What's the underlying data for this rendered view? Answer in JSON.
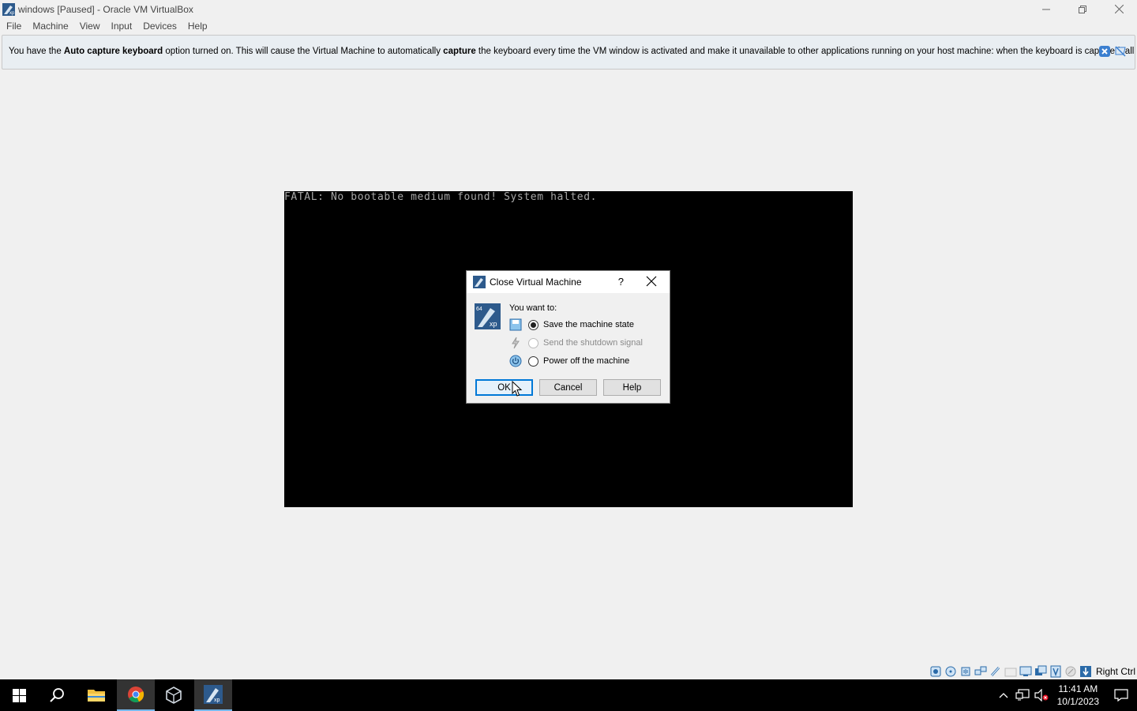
{
  "window": {
    "title": "windows [Paused] - Oracle VM VirtualBox",
    "menu": [
      "File",
      "Machine",
      "View",
      "Input",
      "Devices",
      "Help"
    ]
  },
  "notice": {
    "part1": "You have the ",
    "bold1": "Auto capture keyboard",
    "part2": " option turned on. This will cause the Virtual Machine to automatically ",
    "bold2": "capture",
    "part3": " the keyboard every time the VM window is activated and make it unavailable to other applications running on your host machine: when the keyboard is captured, all"
  },
  "vm_console": {
    "text": "FATAL: No bootable medium found! System halted."
  },
  "dialog": {
    "title": "Close Virtual Machine",
    "help_glyph": "?",
    "prompt": "You want to:",
    "options": [
      {
        "label": "Save the machine state",
        "checked": true,
        "disabled": false
      },
      {
        "label": "Send the shutdown signal",
        "checked": false,
        "disabled": true
      },
      {
        "label": "Power off the machine",
        "checked": false,
        "disabled": false
      }
    ],
    "buttons": {
      "ok": "OK",
      "cancel": "Cancel",
      "help": "Help"
    }
  },
  "status_bar": {
    "host_key": "Right Ctrl"
  },
  "taskbar": {
    "time": "11:41 AM",
    "date": "10/1/2023"
  },
  "colors": {
    "accent": "#0078d7",
    "notice_bg": "#e9eef2",
    "vm_bg": "#000000",
    "taskbar_bg": "#000000"
  }
}
